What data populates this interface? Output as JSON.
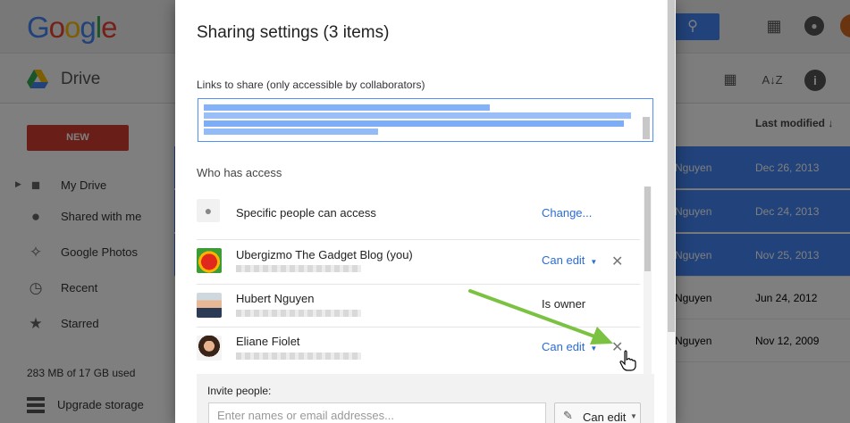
{
  "app": {
    "logo": "Google",
    "product": "Drive",
    "new_button": "NEW",
    "nav": [
      {
        "label": "My Drive",
        "icon": "folder-drive-icon"
      },
      {
        "label": "Shared with me",
        "icon": "people-icon"
      },
      {
        "label": "Google Photos",
        "icon": "pinwheel-icon"
      },
      {
        "label": "Recent",
        "icon": "clock-icon"
      },
      {
        "label": "Starred",
        "icon": "star-icon"
      }
    ],
    "storage_text": "283 MB of 17 GB used",
    "upgrade_label": "Upgrade storage",
    "column_last_modified": "Last modified",
    "files": [
      {
        "owner": "Nguyen",
        "modified": "Dec 26, 2013",
        "selected": true
      },
      {
        "owner": "Nguyen",
        "modified": "Dec 24, 2013",
        "selected": true
      },
      {
        "owner": "Nguyen",
        "modified": "Nov 25, 2013",
        "selected": true
      },
      {
        "owner": "Nguyen",
        "modified": "Jun 24, 2012",
        "selected": false
      },
      {
        "owner": "Nguyen",
        "modified": "Nov 12, 2009",
        "selected": false
      }
    ]
  },
  "dialog": {
    "title": "Sharing settings (3 items)",
    "links_label": "Links to share (only accessible by collaborators)",
    "who_has_access": "Who has access",
    "link_access": {
      "label": "Specific people can access",
      "action": "Change..."
    },
    "people": [
      {
        "name": "Ubergizmo The Gadget Blog (you)",
        "permission": "Can edit",
        "removable": true
      },
      {
        "name": "Hubert Nguyen",
        "permission": "Is owner",
        "removable": false
      },
      {
        "name": "Eliane Fiolet",
        "permission": "Can edit",
        "removable": true
      }
    ],
    "invite_label": "Invite people:",
    "invite_placeholder": "Enter names or email addresses...",
    "invite_permission": "Can edit"
  },
  "colors": {
    "accent": "#4285f4",
    "new_button": "#d23f31",
    "link": "#2a6cd6",
    "annotation_arrow": "#7cc242"
  }
}
